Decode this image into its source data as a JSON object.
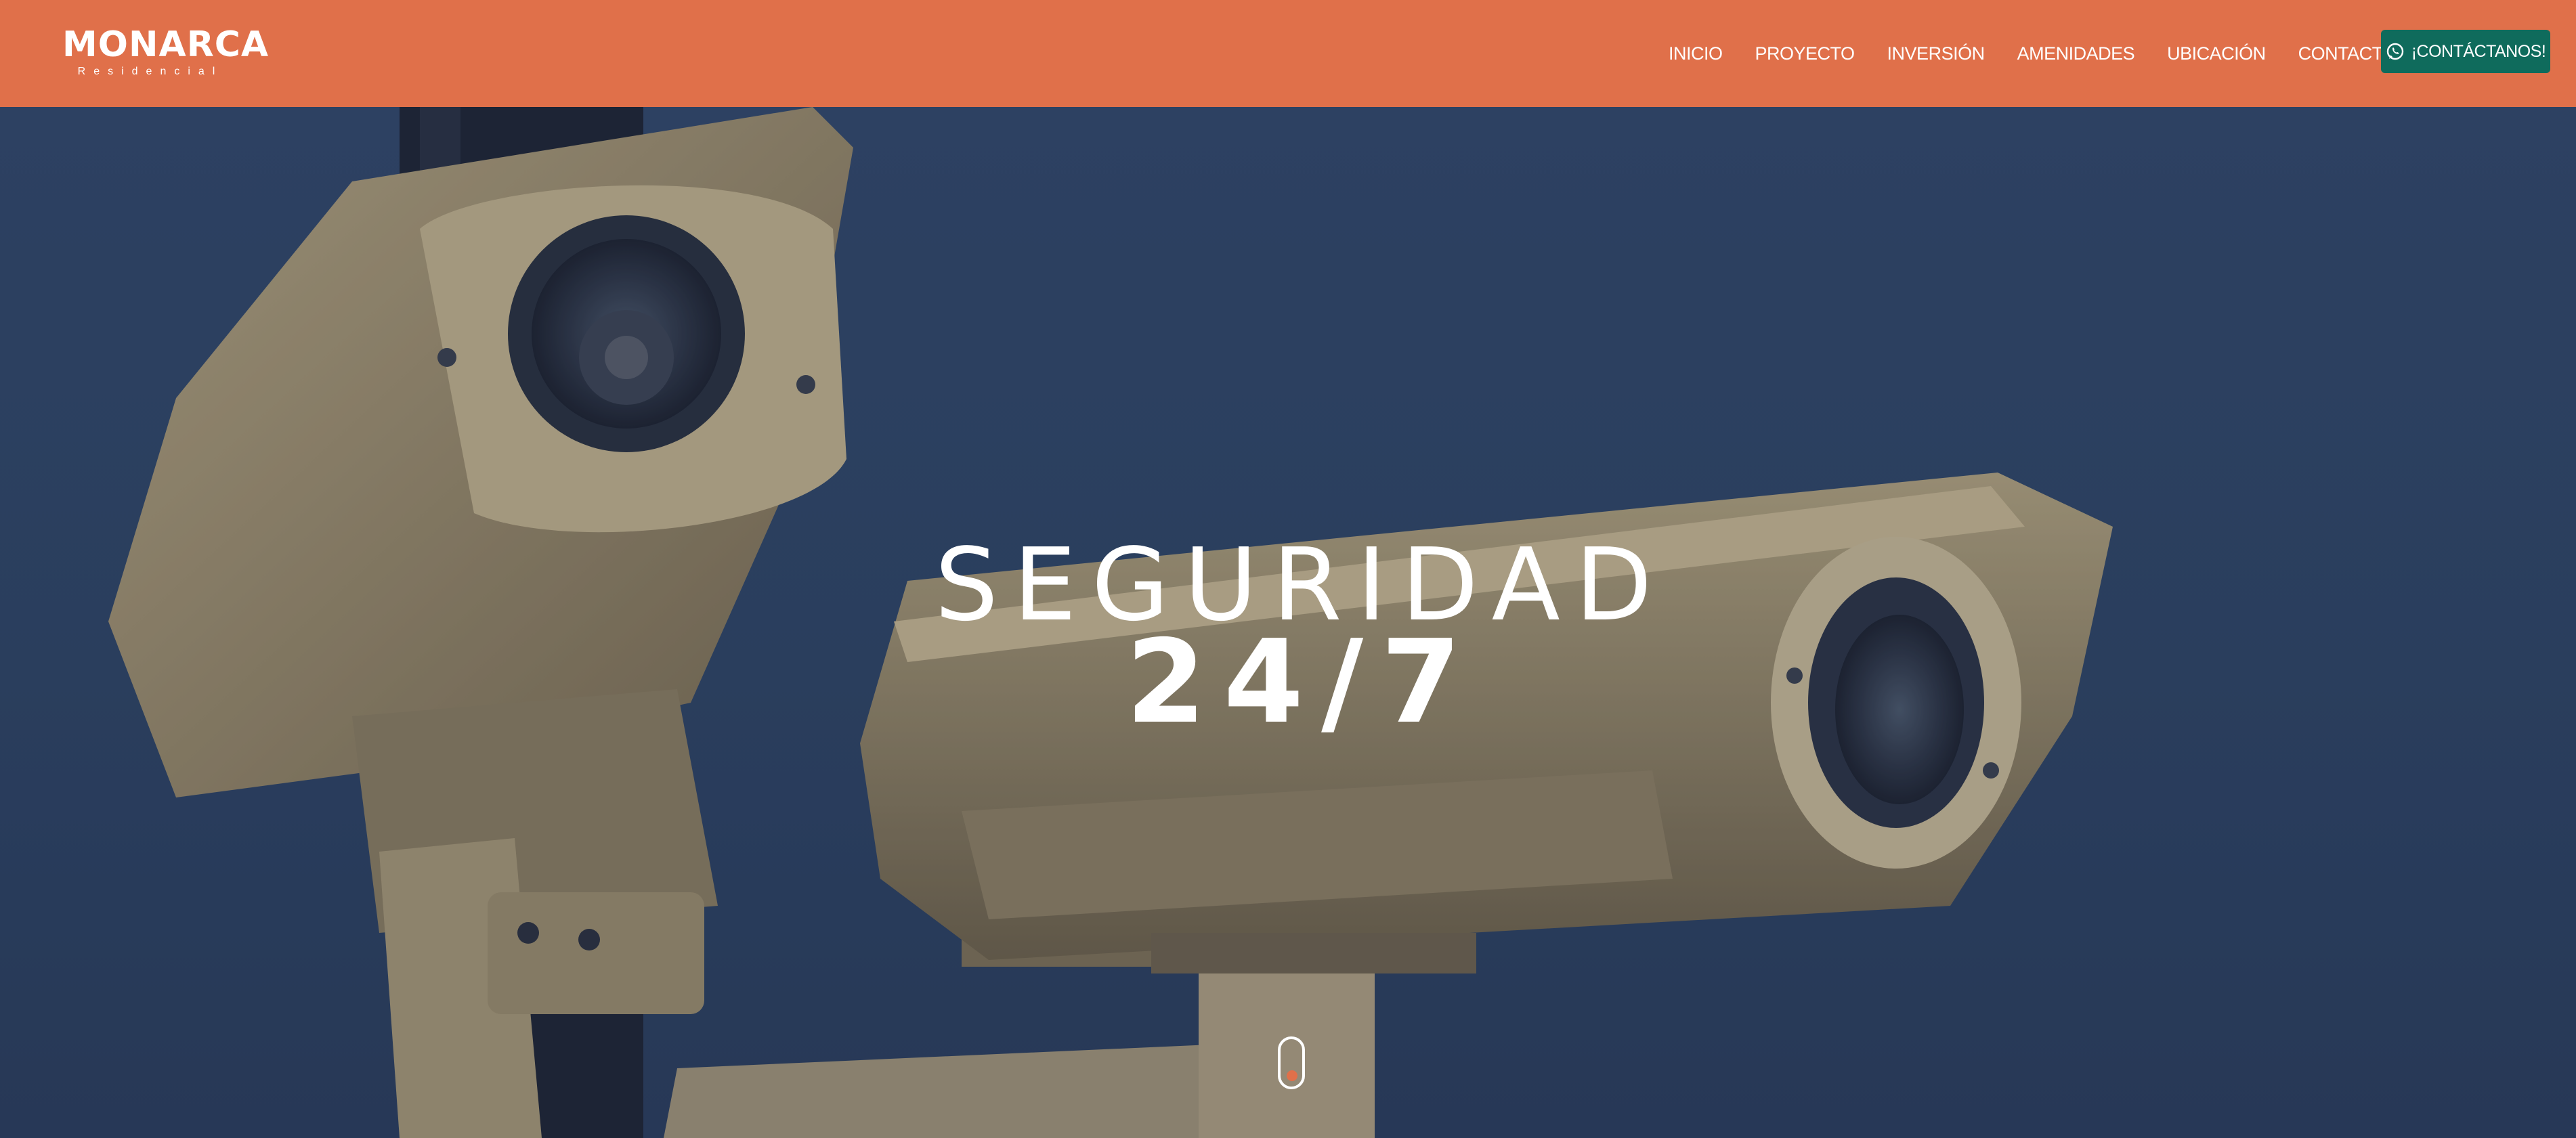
{
  "header": {
    "brand": {
      "name": "MONARCA",
      "tagline": "Residencial"
    },
    "nav": [
      {
        "label": "INICIO"
      },
      {
        "label": "PROYECTO"
      },
      {
        "label": "INVERSIÓN"
      },
      {
        "label": "AMENIDADES"
      },
      {
        "label": "UBICACIÓN"
      },
      {
        "label": "CONTACTO"
      }
    ],
    "cta": {
      "label": "¡CONTÁCTANOS!",
      "icon": "whatsapp-icon"
    }
  },
  "hero": {
    "title_line1": "SEGURIDAD",
    "title_line2": "24/7",
    "background": "security-cameras-photo",
    "scroll_icon": "mouse-scroll-icon"
  },
  "colors": {
    "header_bg": "#e0704a",
    "cta_bg": "#0f6b5c",
    "accent": "#e0704a",
    "text": "#ffffff"
  }
}
